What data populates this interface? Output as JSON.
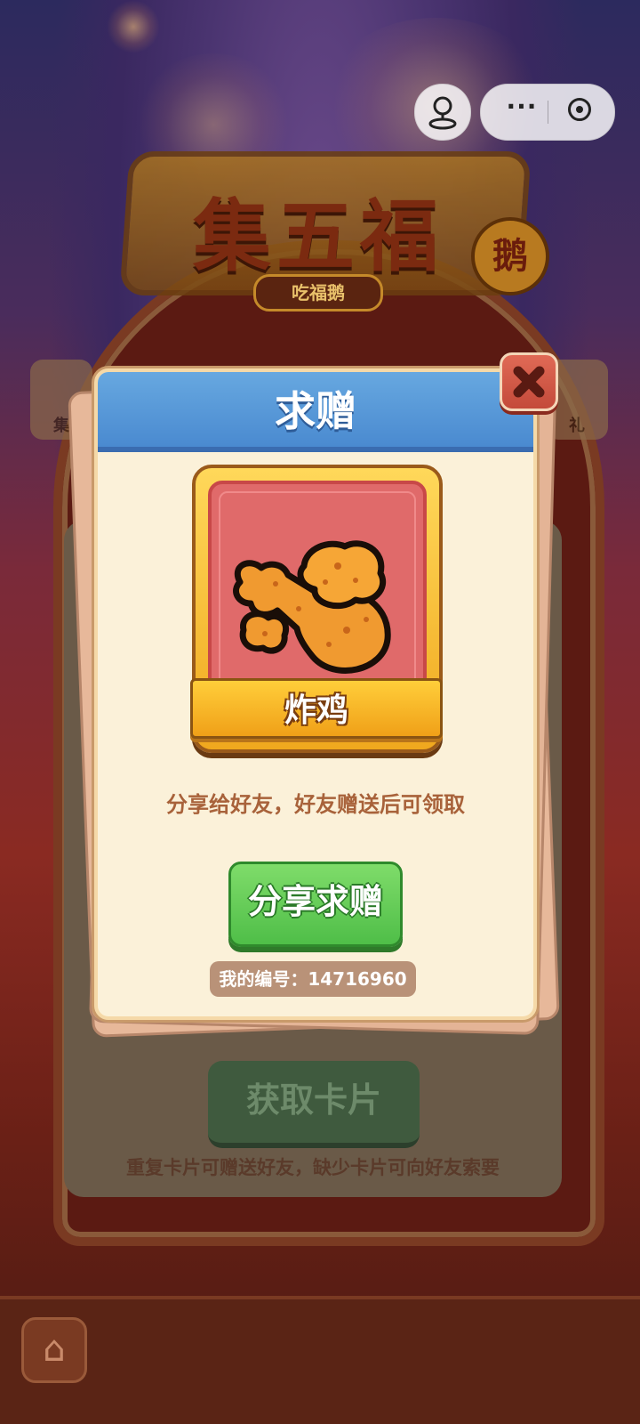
{
  "scene": {
    "title": "集五福",
    "title_badge": "鹅",
    "subtitle": "吃福鹅",
    "side_left_label": "集",
    "side_right_label": "礼",
    "get_cards_label": "获取卡片",
    "hint_text": "重复卡片可赠送好友，缺少卡片可向好友索要"
  },
  "capsule": {
    "more_label": "···"
  },
  "modal": {
    "title": "求赠",
    "card_name": "炸鸡",
    "description": "分享给好友，好友赠送后可领取",
    "share_button": "分享求赠",
    "id_label": "我的编号：14716960"
  },
  "colors": {
    "header_blue": "#4a8ad0",
    "button_green": "#4fbe48",
    "card_red": "#e06a6a",
    "close_red": "#c44a3a",
    "text_brown": "#a8623a"
  },
  "icons": [
    "user-icon",
    "more-icon",
    "target-icon",
    "close-icon",
    "fried-chicken-icon",
    "home-icon"
  ]
}
